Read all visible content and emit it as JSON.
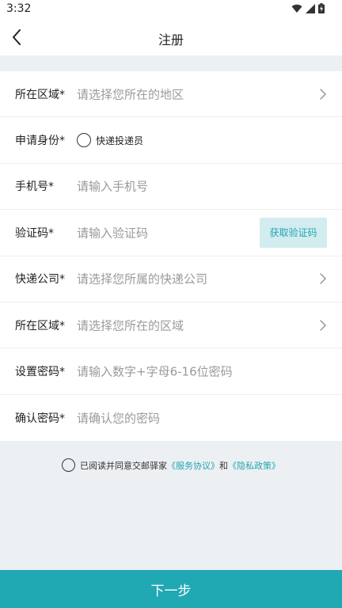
{
  "status_bar": {
    "time": "3:32"
  },
  "header": {
    "title": "注册"
  },
  "form": {
    "rows": [
      {
        "label": "所在区域*",
        "placeholder": "请选择您所在的地区"
      },
      {
        "label": "申请身份*",
        "option": "快递投递员"
      },
      {
        "label": "手机号*",
        "placeholder": "请输入手机号"
      },
      {
        "label": "验证码*",
        "placeholder": "请输入验证码",
        "button": "获取验证码"
      },
      {
        "label": "快递公司*",
        "placeholder": "请选择您所属的快递公司"
      },
      {
        "label": "所在区域*",
        "placeholder": "请选择您所在的区域"
      },
      {
        "label": "设置密码*",
        "placeholder": "请输入数字+字母6-16位密码"
      },
      {
        "label": "确认密码*",
        "placeholder": "请确认您的密码"
      }
    ]
  },
  "agreement": {
    "prefix": "已阅读并同意交邮驿家",
    "service_link": "《服务协议》",
    "conjunction": "和",
    "privacy_link": "《隐私政策》"
  },
  "submit": {
    "label": "下一步"
  },
  "colors": {
    "accent": "#20a8b3",
    "code_button_bg": "#d3ecef",
    "page_bg": "#edf0f3"
  }
}
